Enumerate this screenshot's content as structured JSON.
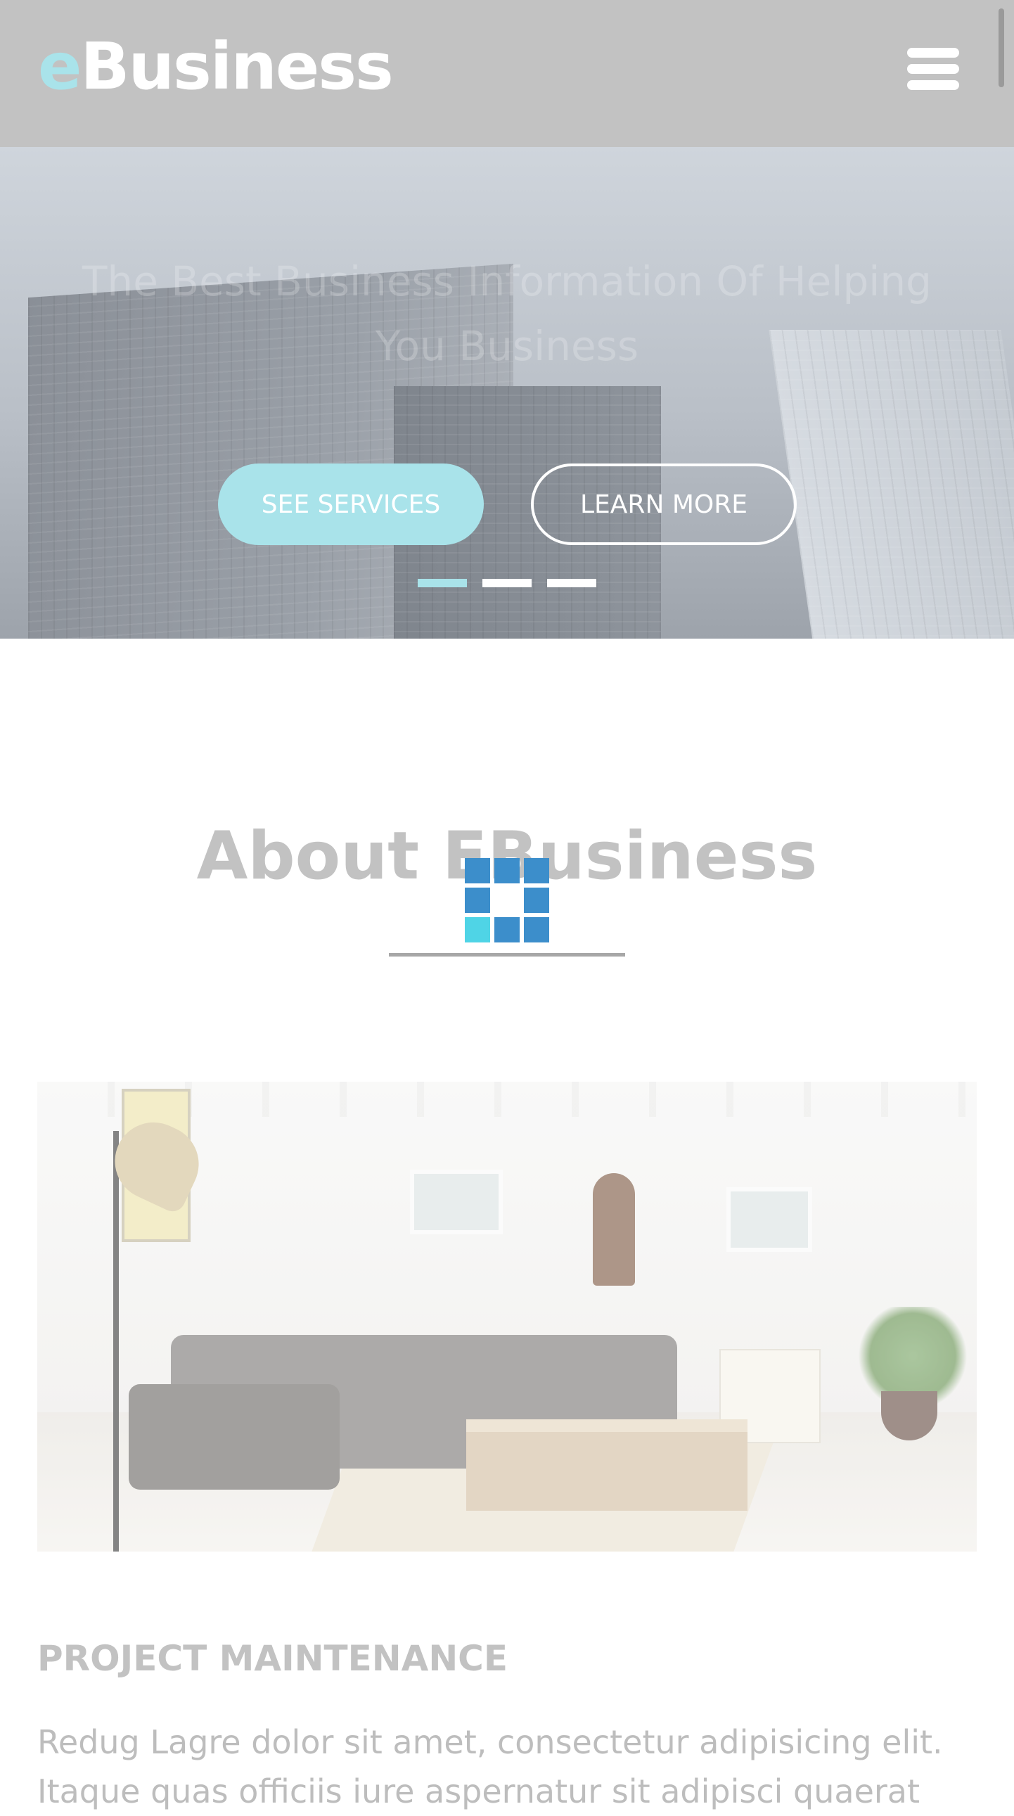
{
  "header": {
    "logo_accent": "e",
    "logo_rest": "Business",
    "menu_icon": "hamburger-menu-icon"
  },
  "hero": {
    "title": "The Best Business Information Of Helping You Business",
    "buttons": {
      "primary_label": "SEE SERVICES",
      "secondary_label": "LEARN MORE"
    },
    "slides_total": 3,
    "active_slide": 1
  },
  "about": {
    "title": "About EBusiness"
  },
  "project": {
    "heading": "PROJECT MAINTENANCE",
    "text": "Redug Lagre dolor sit amet, consectetur adipisicing elit. Itaque quas officiis iure aspernatur sit adipisci quaerat"
  },
  "colors": {
    "accent": "#a9e3ea",
    "header_bg": "#c2c2c2",
    "loader_blue": "#3c8ecb",
    "loader_cyan": "#4fd4e6"
  }
}
